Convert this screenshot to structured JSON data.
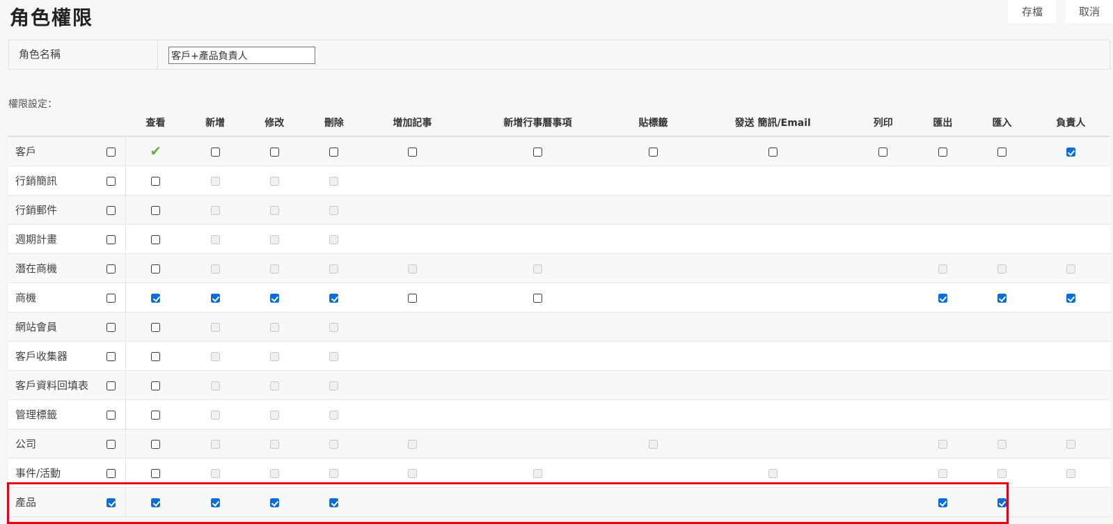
{
  "title": "角色權限",
  "buttons": {
    "save": "存檔",
    "cancel": "取消"
  },
  "role_name_label": "角色名稱",
  "role_name_value": "客戶+產品負責人",
  "section_label": "權限設定：",
  "columns": [
    "查看",
    "新增",
    "修改",
    "刪除",
    "增加記事",
    "新增行事曆事項",
    "貼標籤",
    "發送 簡訊/Email",
    "列印",
    "匯出",
    "匯入",
    "負責人"
  ],
  "rows": [
    {
      "name": "客戶",
      "all": "n",
      "cells": [
        "g",
        "n",
        "n",
        "n",
        "n",
        "n",
        "n",
        "n",
        "n",
        "n",
        "n",
        "c"
      ]
    },
    {
      "name": "行銷簡訊",
      "all": "n",
      "cells": [
        "n",
        "d",
        "d",
        "d",
        "",
        "",
        "",
        "",
        "",
        "",
        "",
        ""
      ]
    },
    {
      "name": "行銷郵件",
      "all": "n",
      "cells": [
        "n",
        "d",
        "d",
        "d",
        "",
        "",
        "",
        "",
        "",
        "",
        "",
        ""
      ]
    },
    {
      "name": "週期計畫",
      "all": "n",
      "cells": [
        "n",
        "d",
        "d",
        "d",
        "",
        "",
        "",
        "",
        "",
        "",
        "",
        ""
      ]
    },
    {
      "name": "潛在商機",
      "all": "n",
      "cells": [
        "n",
        "d",
        "d",
        "d",
        "d",
        "d",
        "",
        "",
        "",
        "d",
        "d",
        "d"
      ]
    },
    {
      "name": "商機",
      "all": "n",
      "cells": [
        "c",
        "c",
        "c",
        "c",
        "n",
        "n",
        "",
        "",
        "",
        "c",
        "c",
        "c"
      ]
    },
    {
      "name": "網站會員",
      "all": "n",
      "cells": [
        "n",
        "d",
        "d",
        "d",
        "",
        "",
        "",
        "",
        "",
        "",
        "",
        ""
      ]
    },
    {
      "name": "客戶收集器",
      "all": "n",
      "cells": [
        "n",
        "d",
        "d",
        "d",
        "",
        "",
        "",
        "",
        "",
        "",
        "",
        ""
      ]
    },
    {
      "name": "客戶資料回填表",
      "all": "n",
      "cells": [
        "n",
        "d",
        "d",
        "d",
        "",
        "",
        "",
        "",
        "",
        "",
        "",
        ""
      ]
    },
    {
      "name": "管理標籤",
      "all": "n",
      "cells": [
        "n",
        "d",
        "d",
        "d",
        "",
        "",
        "",
        "",
        "",
        "",
        "",
        ""
      ]
    },
    {
      "name": "公司",
      "all": "n",
      "cells": [
        "n",
        "d",
        "d",
        "d",
        "d",
        "",
        "d",
        "",
        "",
        "d",
        "d",
        "d"
      ]
    },
    {
      "name": "事件/活動",
      "all": "n",
      "cells": [
        "n",
        "d",
        "d",
        "d",
        "d",
        "d",
        "",
        "d",
        "",
        "d",
        "d",
        "d"
      ]
    },
    {
      "name": "產品",
      "all": "c",
      "cells": [
        "c",
        "c",
        "c",
        "c",
        "",
        "",
        "",
        "",
        "",
        "c",
        "c",
        ""
      ]
    }
  ],
  "colors": {
    "accent": "#0b6dd7",
    "green_check": "#6aaf3e",
    "highlight": "#e60012"
  }
}
